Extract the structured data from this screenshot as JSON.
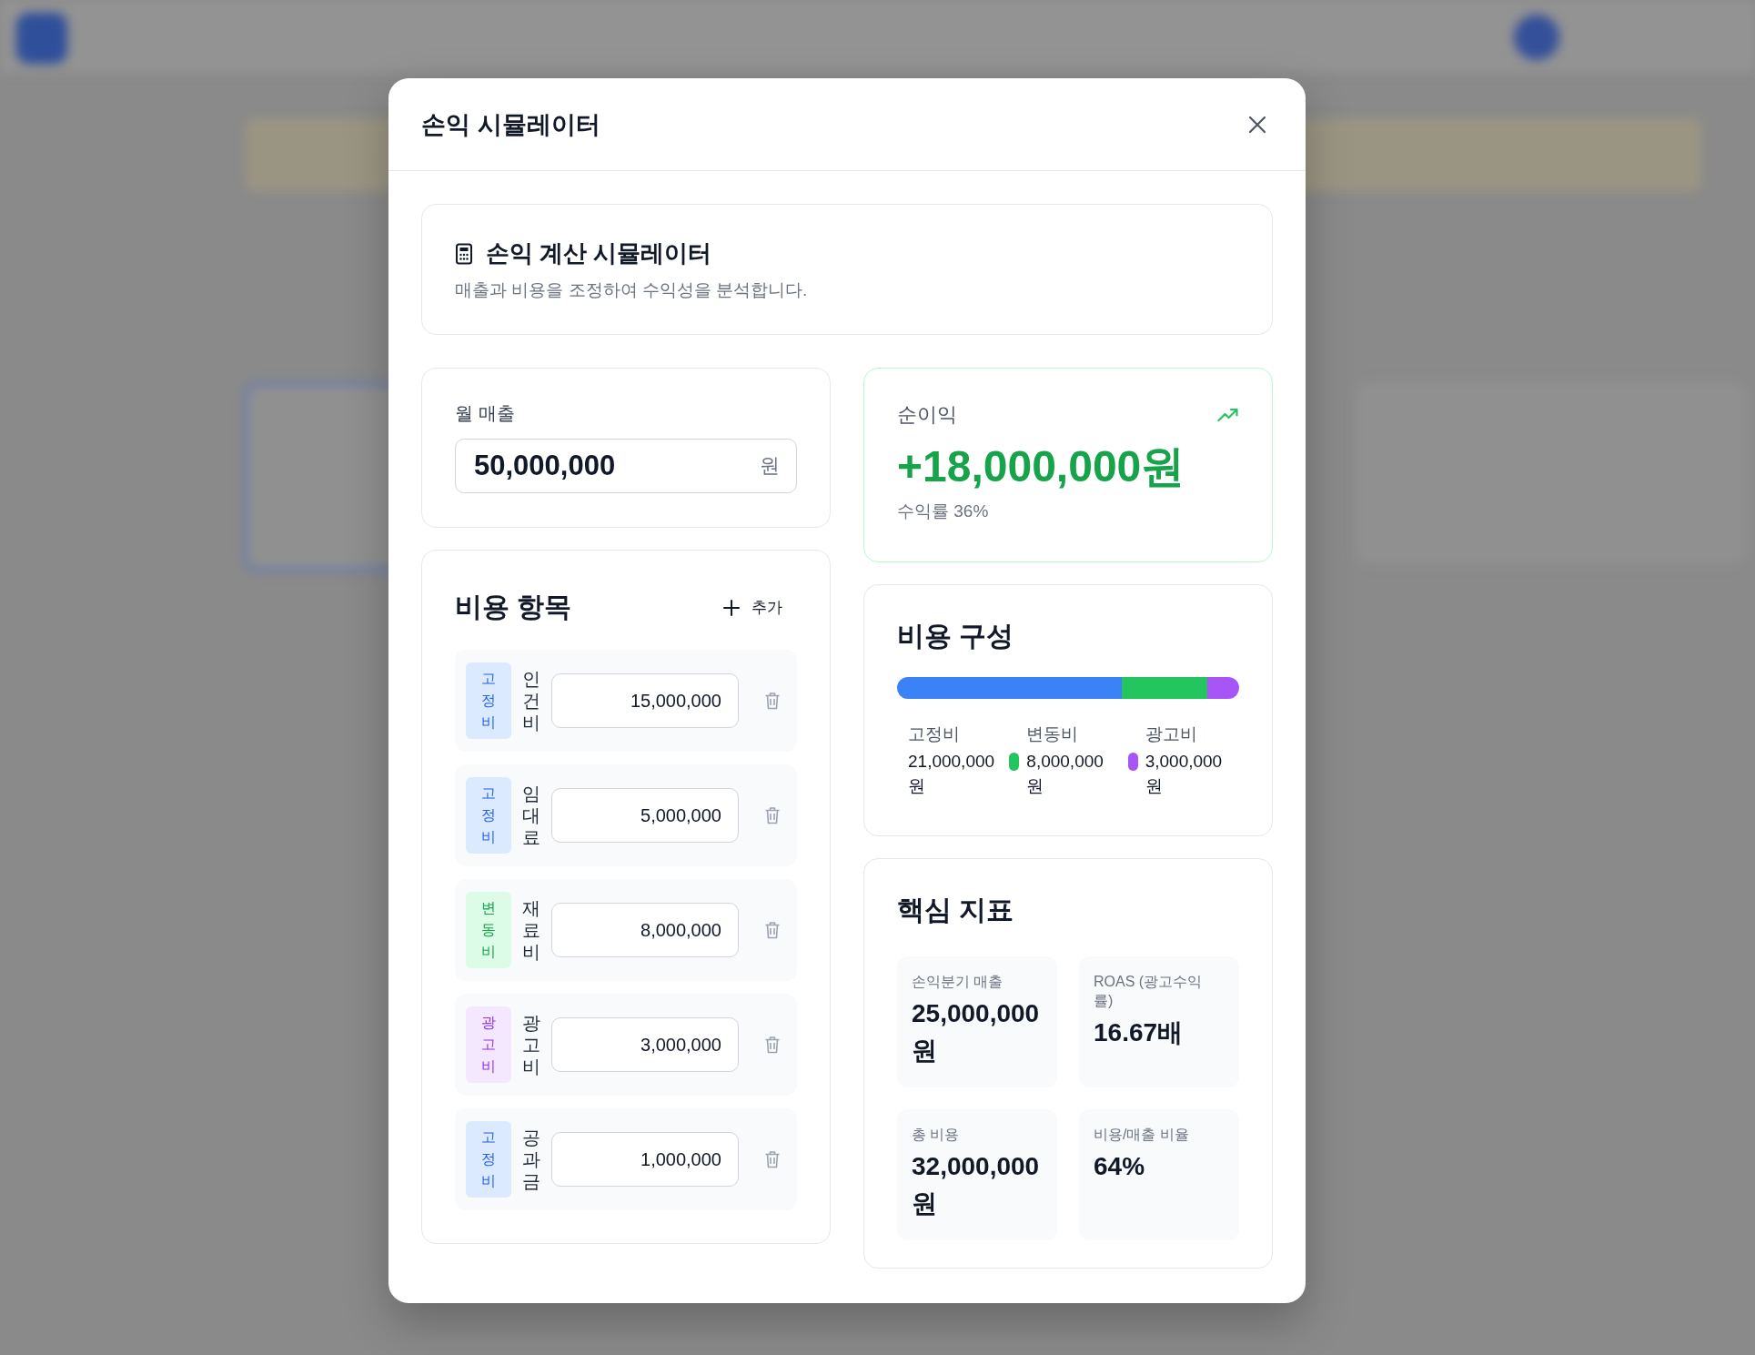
{
  "modal": {
    "title": "손익 시뮬레이터"
  },
  "intro": {
    "title": "손익 계산 시뮬레이터",
    "subtitle": "매출과 비용을 조정하여 수익성을 분석합니다."
  },
  "revenue": {
    "label": "월 매출",
    "value": "50,000,000",
    "unit": "원"
  },
  "costs": {
    "title": "비용 항목",
    "add_label": "추가",
    "items": [
      {
        "kind": "fixed",
        "badge": "고정비",
        "name": "인건비",
        "value": "15,000,000"
      },
      {
        "kind": "fixed",
        "badge": "고정비",
        "name": "임대료",
        "value": "5,000,000"
      },
      {
        "kind": "variable",
        "badge": "변동비",
        "name": "재료비",
        "value": "8,000,000"
      },
      {
        "kind": "ad",
        "badge": "광고비",
        "name": "광고비",
        "value": "3,000,000"
      },
      {
        "kind": "fixed",
        "badge": "고정비",
        "name": "공과금",
        "value": "1,000,000"
      }
    ]
  },
  "profit": {
    "label": "순이익",
    "value": "+18,000,000원",
    "rate": "수익률 36%"
  },
  "composition": {
    "title": "비용 구성",
    "segments": [
      {
        "color": "#3b82f6",
        "level": 0.656
      },
      {
        "color": "#22c55e"
      },
      {
        "color": "#a855f7",
        "level": 0.094
      }
    ],
    "legend": [
      {
        "label": "고정비",
        "value": "21,000,000 원"
      },
      {
        "label": "변동비",
        "value": "8,000,000 원",
        "color": "#22c55e"
      },
      {
        "label": "광고비",
        "value": "3,000,000 원",
        "color": "#a855f7"
      }
    ]
  },
  "metrics": {
    "title": "핵심 지표",
    "items": [
      {
        "label": "손익분기 매출",
        "value": "25,000,000 원"
      },
      {
        "label": "ROAS (광고수익률)",
        "value": "16.67배"
      },
      {
        "label": "총 비용",
        "value": "32,000,000 원"
      },
      {
        "label": "비용/매출 비율",
        "value": "64%"
      }
    ]
  }
}
